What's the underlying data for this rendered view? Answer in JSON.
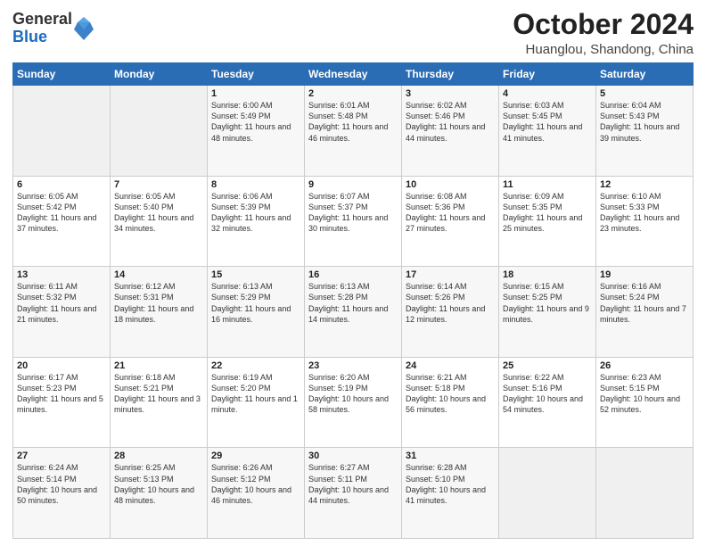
{
  "logo": {
    "general": "General",
    "blue": "Blue"
  },
  "title": "October 2024",
  "subtitle": "Huanglou, Shandong, China",
  "days_header": [
    "Sunday",
    "Monday",
    "Tuesday",
    "Wednesday",
    "Thursday",
    "Friday",
    "Saturday"
  ],
  "weeks": [
    [
      {
        "day": "",
        "info": ""
      },
      {
        "day": "",
        "info": ""
      },
      {
        "day": "1",
        "info": "Sunrise: 6:00 AM\nSunset: 5:49 PM\nDaylight: 11 hours and 48 minutes."
      },
      {
        "day": "2",
        "info": "Sunrise: 6:01 AM\nSunset: 5:48 PM\nDaylight: 11 hours and 46 minutes."
      },
      {
        "day": "3",
        "info": "Sunrise: 6:02 AM\nSunset: 5:46 PM\nDaylight: 11 hours and 44 minutes."
      },
      {
        "day": "4",
        "info": "Sunrise: 6:03 AM\nSunset: 5:45 PM\nDaylight: 11 hours and 41 minutes."
      },
      {
        "day": "5",
        "info": "Sunrise: 6:04 AM\nSunset: 5:43 PM\nDaylight: 11 hours and 39 minutes."
      }
    ],
    [
      {
        "day": "6",
        "info": "Sunrise: 6:05 AM\nSunset: 5:42 PM\nDaylight: 11 hours and 37 minutes."
      },
      {
        "day": "7",
        "info": "Sunrise: 6:05 AM\nSunset: 5:40 PM\nDaylight: 11 hours and 34 minutes."
      },
      {
        "day": "8",
        "info": "Sunrise: 6:06 AM\nSunset: 5:39 PM\nDaylight: 11 hours and 32 minutes."
      },
      {
        "day": "9",
        "info": "Sunrise: 6:07 AM\nSunset: 5:37 PM\nDaylight: 11 hours and 30 minutes."
      },
      {
        "day": "10",
        "info": "Sunrise: 6:08 AM\nSunset: 5:36 PM\nDaylight: 11 hours and 27 minutes."
      },
      {
        "day": "11",
        "info": "Sunrise: 6:09 AM\nSunset: 5:35 PM\nDaylight: 11 hours and 25 minutes."
      },
      {
        "day": "12",
        "info": "Sunrise: 6:10 AM\nSunset: 5:33 PM\nDaylight: 11 hours and 23 minutes."
      }
    ],
    [
      {
        "day": "13",
        "info": "Sunrise: 6:11 AM\nSunset: 5:32 PM\nDaylight: 11 hours and 21 minutes."
      },
      {
        "day": "14",
        "info": "Sunrise: 6:12 AM\nSunset: 5:31 PM\nDaylight: 11 hours and 18 minutes."
      },
      {
        "day": "15",
        "info": "Sunrise: 6:13 AM\nSunset: 5:29 PM\nDaylight: 11 hours and 16 minutes."
      },
      {
        "day": "16",
        "info": "Sunrise: 6:13 AM\nSunset: 5:28 PM\nDaylight: 11 hours and 14 minutes."
      },
      {
        "day": "17",
        "info": "Sunrise: 6:14 AM\nSunset: 5:26 PM\nDaylight: 11 hours and 12 minutes."
      },
      {
        "day": "18",
        "info": "Sunrise: 6:15 AM\nSunset: 5:25 PM\nDaylight: 11 hours and 9 minutes."
      },
      {
        "day": "19",
        "info": "Sunrise: 6:16 AM\nSunset: 5:24 PM\nDaylight: 11 hours and 7 minutes."
      }
    ],
    [
      {
        "day": "20",
        "info": "Sunrise: 6:17 AM\nSunset: 5:23 PM\nDaylight: 11 hours and 5 minutes."
      },
      {
        "day": "21",
        "info": "Sunrise: 6:18 AM\nSunset: 5:21 PM\nDaylight: 11 hours and 3 minutes."
      },
      {
        "day": "22",
        "info": "Sunrise: 6:19 AM\nSunset: 5:20 PM\nDaylight: 11 hours and 1 minute."
      },
      {
        "day": "23",
        "info": "Sunrise: 6:20 AM\nSunset: 5:19 PM\nDaylight: 10 hours and 58 minutes."
      },
      {
        "day": "24",
        "info": "Sunrise: 6:21 AM\nSunset: 5:18 PM\nDaylight: 10 hours and 56 minutes."
      },
      {
        "day": "25",
        "info": "Sunrise: 6:22 AM\nSunset: 5:16 PM\nDaylight: 10 hours and 54 minutes."
      },
      {
        "day": "26",
        "info": "Sunrise: 6:23 AM\nSunset: 5:15 PM\nDaylight: 10 hours and 52 minutes."
      }
    ],
    [
      {
        "day": "27",
        "info": "Sunrise: 6:24 AM\nSunset: 5:14 PM\nDaylight: 10 hours and 50 minutes."
      },
      {
        "day": "28",
        "info": "Sunrise: 6:25 AM\nSunset: 5:13 PM\nDaylight: 10 hours and 48 minutes."
      },
      {
        "day": "29",
        "info": "Sunrise: 6:26 AM\nSunset: 5:12 PM\nDaylight: 10 hours and 46 minutes."
      },
      {
        "day": "30",
        "info": "Sunrise: 6:27 AM\nSunset: 5:11 PM\nDaylight: 10 hours and 44 minutes."
      },
      {
        "day": "31",
        "info": "Sunrise: 6:28 AM\nSunset: 5:10 PM\nDaylight: 10 hours and 41 minutes."
      },
      {
        "day": "",
        "info": ""
      },
      {
        "day": "",
        "info": ""
      }
    ]
  ]
}
